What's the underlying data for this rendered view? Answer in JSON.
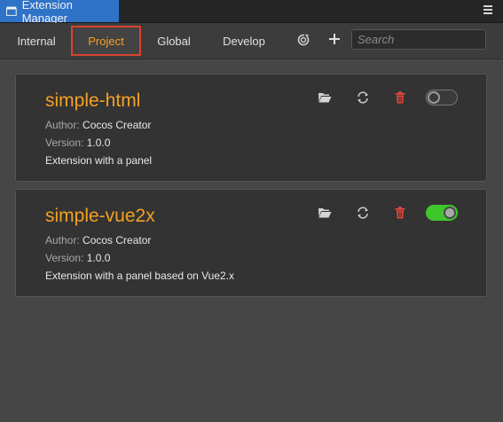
{
  "window": {
    "title": "Extension Manager"
  },
  "toolbar": {
    "tabs": [
      {
        "label": "Internal",
        "active": false
      },
      {
        "label": "Project",
        "active": true
      },
      {
        "label": "Global",
        "active": false
      },
      {
        "label": "Develop",
        "active": false
      }
    ],
    "search_placeholder": "Search",
    "icons": [
      "refresh-icon",
      "add-icon"
    ]
  },
  "extensions": [
    {
      "name": "simple-html",
      "author_label": "Author:",
      "author": "Cocos Creator",
      "version_label": "Version:",
      "version": "1.0.0",
      "description": "Extension with a panel",
      "enabled": false
    },
    {
      "name": "simple-vue2x",
      "author_label": "Author:",
      "author": "Cocos Creator",
      "version_label": "Version:",
      "version": "1.0.0",
      "description": "Extension with a panel based on Vue2.x",
      "enabled": true
    }
  ],
  "colors": {
    "accent": "#f5a023",
    "title_tab": "#2f73c9",
    "active_outline": "#d9432f",
    "delete": "#e0473a",
    "toggle_on": "#3fc62c"
  }
}
